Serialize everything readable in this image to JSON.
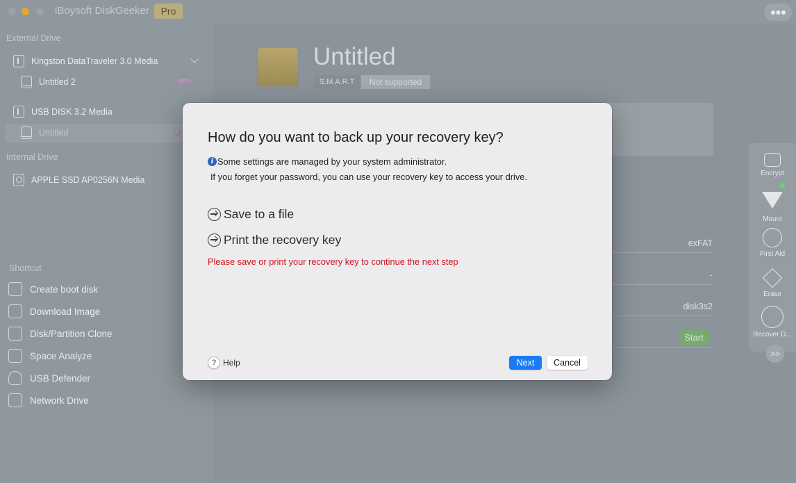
{
  "app": {
    "title": "iBoysoft DiskGeeker",
    "badge": "Pro"
  },
  "sidebar": {
    "external_title": "External Drive",
    "external_drives": [
      {
        "label": "Kingston DataTraveler 3.0 Media",
        "icon": "usb-drive-icon"
      },
      {
        "label": "Untitled 2",
        "icon": "volume-icon",
        "fs": "HFS+"
      },
      {
        "label": "USB DISK 3.2 Media",
        "icon": "usb-drive-icon"
      },
      {
        "label": "Untitled",
        "icon": "volume-icon",
        "fs": "E"
      }
    ],
    "internal_title": "Internal Drive",
    "internal_drives": [
      {
        "label": "APPLE SSD AP0256N Media",
        "icon": "ssd-icon"
      }
    ],
    "shortcut_title": "Shortcut",
    "shortcuts": [
      {
        "label": "Create boot disk",
        "icon": "boot-disk-icon"
      },
      {
        "label": "Download Image",
        "icon": "download-icon"
      },
      {
        "label": "Disk/Partition Clone",
        "icon": "clone-icon"
      },
      {
        "label": "Space Analyze",
        "icon": "analyze-icon"
      },
      {
        "label": "USB Defender",
        "icon": "shield-icon"
      },
      {
        "label": "Network Drive",
        "icon": "network-drive-icon"
      }
    ]
  },
  "main": {
    "title": "Untitled",
    "smart_label": "S.M.A.R.T",
    "smart_value": "Not supported",
    "props": [
      "exFAT",
      "-",
      "disk3s2"
    ],
    "start_label": "Start"
  },
  "toolbar": {
    "items": [
      {
        "label": "Encrypt",
        "icon": "lock-icon"
      },
      {
        "label": "Mount",
        "icon": "mount-icon"
      },
      {
        "label": "First Aid",
        "icon": "stethoscope-icon"
      },
      {
        "label": "Erase",
        "icon": "eraser-icon"
      },
      {
        "label": "Recover D...",
        "icon": "recover-icon"
      }
    ],
    "expand": ">>"
  },
  "dialog": {
    "title": "How do you want to back up your recovery key?",
    "info_line1": "Some settings are managed by your system administrator.",
    "info_line2": "If you forget your password, you can use your recovery key to access your drive.",
    "option_file": "Save to a file",
    "option_print": "Print the recovery key",
    "warning": "Please save or print your recovery key to continue the next step",
    "help_label": "Help",
    "next_label": "Next",
    "cancel_label": "Cancel",
    "colors": {
      "accent": "#1a7cf3",
      "warning": "#d0121b"
    }
  }
}
